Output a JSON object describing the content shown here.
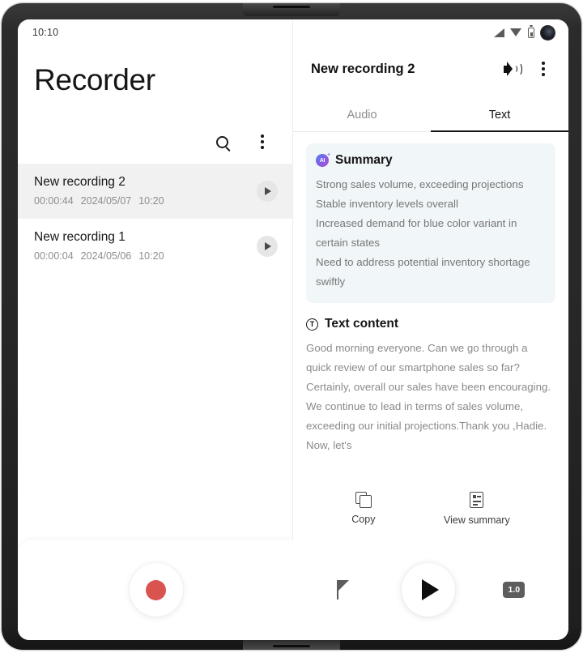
{
  "status_bar": {
    "clock": "10:10",
    "icons": [
      "signal-icon",
      "wifi-icon",
      "battery-icon",
      "camera-icon"
    ]
  },
  "left_panel": {
    "app_title": "Recorder",
    "toolbar": {
      "search_icon": "search-icon",
      "overflow_icon": "more-vertical-icon"
    },
    "recordings": [
      {
        "name": "New recording 2",
        "duration": "00:00:44",
        "date": "2024/05/07",
        "time": "10:20",
        "selected": true
      },
      {
        "name": "New recording 1",
        "duration": "00:00:04",
        "date": "2024/05/06",
        "time": "10:20",
        "selected": false
      }
    ],
    "record_button": "record-button"
  },
  "right_panel": {
    "title": "New recording 2",
    "speaker_icon": "speaker-icon",
    "overflow_icon": "more-vertical-icon",
    "tabs": [
      {
        "label": "Audio",
        "active": false
      },
      {
        "label": "Text",
        "active": true
      }
    ],
    "summary": {
      "heading": "Summary",
      "ai_icon": "ai-sparkle-icon",
      "lines": [
        "Strong sales volume, exceeding projections",
        "Stable inventory levels overall",
        "Increased demand for blue color variant in certain states",
        "Need to address potential inventory shortage swiftly"
      ]
    },
    "text_content": {
      "heading": "Text content",
      "icon_letter": "T",
      "transcript": "Good morning everyone. Can we go through a quick review of our smartphone sales so far? Certainly, overall our sales have been encouraging. We continue to lead in terms of sales volume, exceeding our initial projections.Thank you ,Hadie. Now, let's"
    },
    "actions": [
      {
        "label": "Copy",
        "icon": "copy-icon"
      },
      {
        "label": "View summary",
        "icon": "document-list-icon"
      }
    ],
    "player": {
      "flag_icon": "flag-marker-icon",
      "play_icon": "play-icon",
      "speed": "1.0"
    }
  },
  "colors": {
    "accent_record": "#d9534f",
    "summary_card_bg": "#f1f6f8",
    "selected_row_bg": "#f1f1f1",
    "muted_text": "#8d8d8d",
    "primary_text": "#141414"
  }
}
